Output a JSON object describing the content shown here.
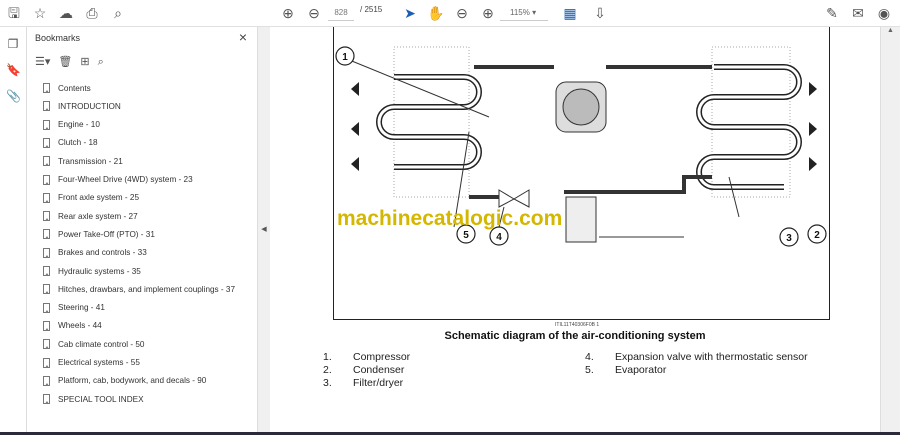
{
  "toolbar": {
    "page_current": "828",
    "page_total": "/ 2515",
    "zoom": "115%",
    "icons": [
      "save-icon",
      "bookmark-star-icon",
      "upload-icon",
      "print-icon",
      "search-icon",
      "prev-page-icon",
      "next-page-icon",
      "select-cursor-icon",
      "hand-icon",
      "zoom-out-icon",
      "zoom-in-icon",
      "page-fit-icon",
      "read-mode-icon",
      "sign-icon",
      "email-icon",
      "account-icon"
    ]
  },
  "bookmarks": {
    "title": "Bookmarks",
    "items": [
      "Contents",
      "INTRODUCTION",
      "Engine - 10",
      "Clutch - 18",
      "Transmission - 21",
      "Four-Wheel Drive (4WD) system - 23",
      "Front axle system - 25",
      "Rear axle system - 27",
      "Power Take-Off (PTO) - 31",
      "Brakes and controls - 33",
      "Hydraulic systems - 35",
      "Hitches, drawbars, and implement couplings - 37",
      "Steering - 41",
      "Wheels - 44",
      "Cab climate control - 50",
      "Electrical systems - 55",
      "Platform, cab, bodywork, and decals - 90",
      "SPECIAL TOOL INDEX"
    ]
  },
  "document": {
    "watermark": "machinecatalogic.com",
    "figure_id": "ITIL11T40306F0B    1",
    "caption": "Schematic diagram of the air-conditioning system",
    "callouts": [
      "1",
      "2",
      "3",
      "4",
      "5"
    ],
    "legend": [
      {
        "num": "1.",
        "label": "Compressor"
      },
      {
        "num": "2.",
        "label": "Condenser"
      },
      {
        "num": "3.",
        "label": "Filter/dryer"
      },
      {
        "num": "4.",
        "label": "Expansion valve with thermostatic sensor"
      },
      {
        "num": "5.",
        "label": "Evaporator"
      }
    ]
  }
}
